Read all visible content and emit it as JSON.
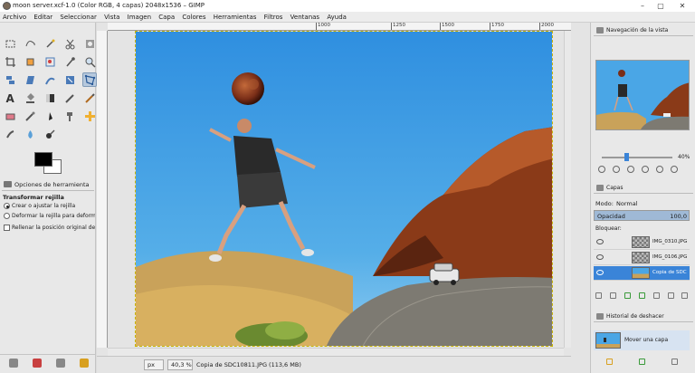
{
  "window": {
    "title": "moon server.xcf-1.0 (Color RGB, 4 capas) 2048x1536 – GIMP",
    "minimize": "–",
    "maximize": "▢",
    "close": "✕"
  },
  "menu": [
    "Archivo",
    "Editar",
    "Seleccionar",
    "Vista",
    "Imagen",
    "Capa",
    "Colores",
    "Herramientas",
    "Filtros",
    "Ventanas",
    "Ayuda"
  ],
  "tool_options": {
    "tab_label": "Opciones de herramienta",
    "title": "Transformar rejilla",
    "option1": "Crear o ajustar la rejilla",
    "option2": "Deformar la rejilla para deformar la im",
    "checkbox_label": "Rellenar la posición original de la jaula"
  },
  "ruler": {
    "ticks": [
      "1000",
      "1250",
      "1500",
      "1750",
      "2000"
    ]
  },
  "status": {
    "unit": "px",
    "zoom": "40,3 %",
    "text": "Copia de SDC10811.JPG (113,6 MB)"
  },
  "navigation": {
    "tab_label": "Navegación de la vista",
    "zoom_label": "40%"
  },
  "layers": {
    "tab_label": "Capas",
    "mode_label": "Modo:",
    "mode_value": "Normal",
    "opacity_label": "Opacidad",
    "opacity_value": "100,0",
    "opacity_fraction": 1.0,
    "lock_label": "Bloquear:",
    "items": [
      {
        "name": "IMG_0310.JPG",
        "selected": false
      },
      {
        "name": "IMG_0106.JPG",
        "selected": false
      },
      {
        "name": "Copia de SDC",
        "selected": true
      }
    ]
  },
  "history": {
    "tab_label": "Historial de deshacer",
    "item": "Mover una capa"
  },
  "colors": {
    "accent": "#3a84d8",
    "sky": "#4aa6e6",
    "foreground": "#000000",
    "background": "#ffffff"
  }
}
